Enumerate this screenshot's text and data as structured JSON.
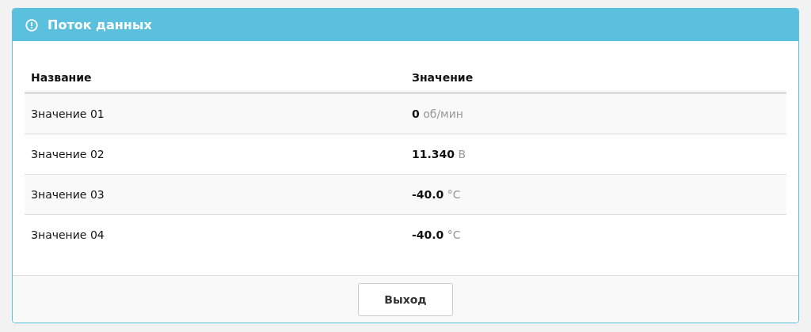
{
  "panel": {
    "title": "Поток данных"
  },
  "table": {
    "columns": [
      "Название",
      "Значение"
    ],
    "rows": [
      {
        "name": "Значение 01",
        "value": "0",
        "unit": "об/мин"
      },
      {
        "name": "Значение 02",
        "value": "11.340",
        "unit": "В"
      },
      {
        "name": "Значение 03",
        "value": "-40.0",
        "unit": "°C"
      },
      {
        "name": "Значение 04",
        "value": "-40.0",
        "unit": "°C"
      }
    ]
  },
  "buttons": [
    "Выход"
  ]
}
